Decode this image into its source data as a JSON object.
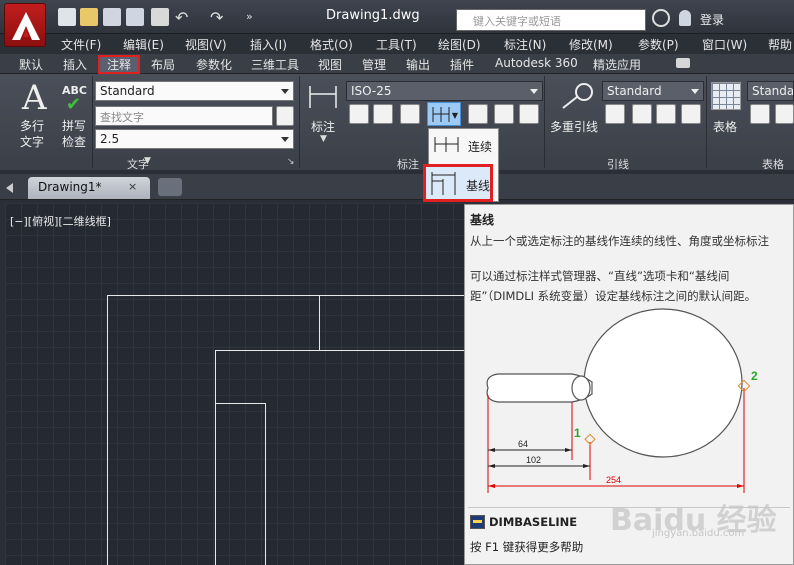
{
  "app": {
    "file_title": "Drawing1.dwg",
    "search_placeholder": "键入关键字或短语",
    "login_label": "登录"
  },
  "menubar": [
    "文件(F)",
    "编辑(E)",
    "视图(V)",
    "插入(I)",
    "格式(O)",
    "工具(T)",
    "绘图(D)",
    "标注(N)",
    "修改(M)",
    "参数(P)",
    "窗口(W)",
    "帮助"
  ],
  "ribbon_tabs": [
    "默认",
    "插入",
    "注释",
    "布局",
    "参数化",
    "三维工具",
    "视图",
    "管理",
    "输出",
    "插件",
    "Autodesk 360",
    "精选应用"
  ],
  "ribbon": {
    "text_panel": {
      "mtext_label_1": "多行",
      "mtext_label_2": "文字",
      "abc_label": "ABC",
      "spell_label_1": "拼写",
      "spell_label_2": "检查",
      "text_style": "Standard",
      "find_placeholder": "查找文字",
      "text_height": "2.5",
      "title": "文字"
    },
    "dim_panel": {
      "dim_label": "标注",
      "dim_style": "ISO-25",
      "title": "标注"
    },
    "leader_panel": {
      "mleader_label": "多重引线",
      "mleader_style": "Standard",
      "title": "引线"
    },
    "table_panel": {
      "table_label": "表格",
      "table_style": "Standard",
      "title": "表格"
    }
  },
  "dropdown": {
    "item_continue": "连续",
    "item_baseline": "基线"
  },
  "document": {
    "tab_title": "Drawing1*",
    "close_glyph": "×",
    "viewport_label": "[−][俯视][二维线框]"
  },
  "tooltip": {
    "title": "基线",
    "description": "从上一个或选定标注的基线作连续的线性、角度或坐标标注",
    "body": "可以通过标注样式管理器、“直线”选项卡和“基线间距”（DIMDLI 系统变量）设定基线标注之间的默认间距。",
    "illustration": {
      "dim_64": "64",
      "dim_102": "102",
      "dim_254": "254",
      "point_1": "1",
      "point_2": "2"
    },
    "command": "DIMBASELINE",
    "help": "按 F1 键获得更多帮助"
  },
  "watermark": {
    "brand": "Baidu 经验",
    "url": "jingyan.baidu.com"
  },
  "colors": {
    "highlight": "#e02020",
    "canvas": "#252932",
    "ribbon": "#444953",
    "marker_green": "#2aa82a",
    "marker_orange": "#e08a2a"
  }
}
